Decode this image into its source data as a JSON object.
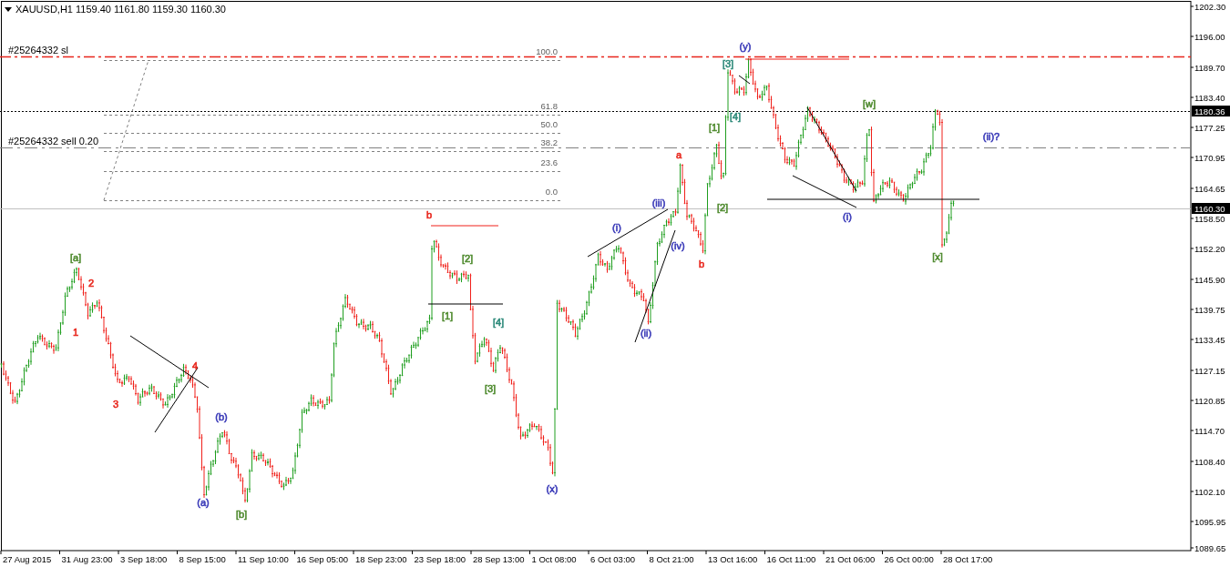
{
  "header": {
    "symbol": "XAUUSD,H1",
    "ohlc": "1159.40 1161.80 1159.30 1160.30"
  },
  "order_lines": [
    {
      "label": "#25264332 sl",
      "kind": "stop"
    },
    {
      "label": "#25264332 sell 0.20",
      "kind": "entry"
    }
  ],
  "fibonacci_levels": [
    "100.0",
    "61.8",
    "50.0",
    "38.2",
    "23.6",
    "0.0"
  ],
  "wave_labels": [
    {
      "text": "[a]",
      "color": "#4e8a2e"
    },
    {
      "text": "2",
      "color": "#e8271d"
    },
    {
      "text": "1",
      "color": "#e8271d"
    },
    {
      "text": "3",
      "color": "#e8271d"
    },
    {
      "text": "4",
      "color": "#e8271d"
    },
    {
      "text": "(b)",
      "color": "#3a3ab8"
    },
    {
      "text": "(a)",
      "color": "#3a3ab8"
    },
    {
      "text": "[b]",
      "color": "#4e8a2e"
    },
    {
      "text": "b",
      "color": "#e8271d"
    },
    {
      "text": "[2]",
      "color": "#4e8a2e"
    },
    {
      "text": "[1]",
      "color": "#4e8a2e"
    },
    {
      "text": "[4]",
      "color": "#2e8a7a"
    },
    {
      "text": "[3]",
      "color": "#4e8a2e"
    },
    {
      "text": "(x)",
      "color": "#3a3ab8"
    },
    {
      "text": "(i)",
      "color": "#3a3ab8"
    },
    {
      "text": "(iii)",
      "color": "#3a3ab8"
    },
    {
      "text": "(iv)",
      "color": "#3a3ab8"
    },
    {
      "text": "(ii)",
      "color": "#3a3ab8"
    },
    {
      "text": "a",
      "color": "#e8271d"
    },
    {
      "text": "b",
      "color": "#e8271d"
    },
    {
      "text": "[1]",
      "color": "#4e8a2e"
    },
    {
      "text": "[2]",
      "color": "#4e8a2e"
    },
    {
      "text": "[3]",
      "color": "#2e8a7a"
    },
    {
      "text": "[4]",
      "color": "#2e8a7a"
    },
    {
      "text": "(y)",
      "color": "#3a3ab8"
    },
    {
      "text": "[w]",
      "color": "#4e8a2e"
    },
    {
      "text": "(i)",
      "color": "#3a3ab8"
    },
    {
      "text": "[x]",
      "color": "#4e8a2e"
    },
    {
      "text": "(ii)?",
      "color": "#3a3ab8"
    }
  ],
  "price_axis": [
    {
      "label": "1202.30",
      "highlighted": false
    },
    {
      "label": "1196.00",
      "highlighted": false
    },
    {
      "label": "1189.70",
      "highlighted": false
    },
    {
      "label": "1183.40",
      "highlighted": false
    },
    {
      "label": "1180.36",
      "highlighted": true
    },
    {
      "label": "1177.25",
      "highlighted": false
    },
    {
      "label": "1170.95",
      "highlighted": false
    },
    {
      "label": "1164.65",
      "highlighted": false
    },
    {
      "label": "1160.30",
      "highlighted": true
    },
    {
      "label": "1158.50",
      "highlighted": false
    },
    {
      "label": "1152.20",
      "highlighted": false
    },
    {
      "label": "1145.90",
      "highlighted": false
    },
    {
      "label": "1139.75",
      "highlighted": false
    },
    {
      "label": "1133.45",
      "highlighted": false
    },
    {
      "label": "1127.15",
      "highlighted": false
    },
    {
      "label": "1120.85",
      "highlighted": false
    },
    {
      "label": "1114.70",
      "highlighted": false
    },
    {
      "label": "1108.40",
      "highlighted": false
    },
    {
      "label": "1102.10",
      "highlighted": false
    },
    {
      "label": "1095.95",
      "highlighted": false
    },
    {
      "label": "1089.65",
      "highlighted": false
    }
  ],
  "time_axis": [
    "27 Aug 2015",
    "31 Aug 23:00",
    "3 Sep 18:00",
    "8 Sep 15:00",
    "11 Sep 10:00",
    "16 Sep 05:00",
    "18 Sep 23:00",
    "23 Sep 18:00",
    "28 Sep 13:00",
    "1 Oct 08:00",
    "6 Oct 03:00",
    "8 Oct 21:00",
    "13 Oct 16:00",
    "16 Oct 11:00",
    "21 Oct 06:00",
    "26 Oct 00:00",
    "28 Oct 17:00"
  ]
}
